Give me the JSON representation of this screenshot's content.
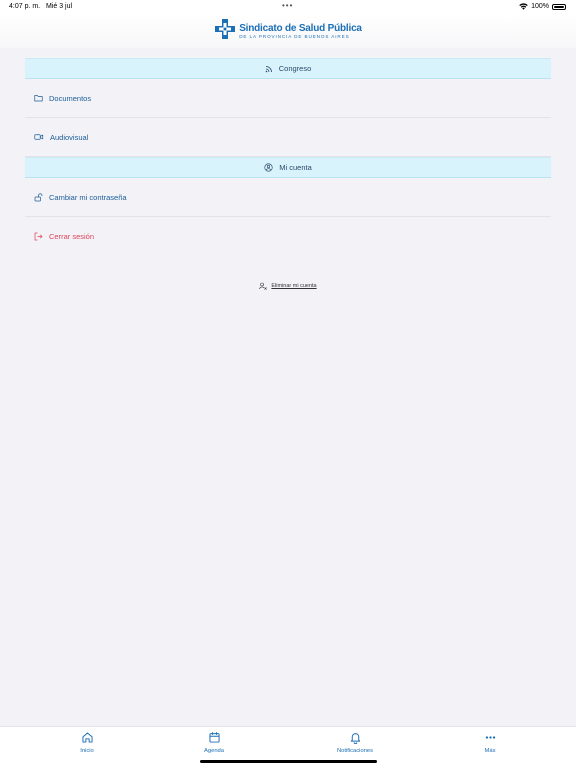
{
  "status": {
    "time": "4:07 p. m.",
    "date": "Mié 3 jul",
    "dots": "•••",
    "battery": "100%",
    "battery_level": 1.0
  },
  "header": {
    "logo_title": "Sindicato de Salud Pública",
    "logo_subtitle": "DE LA PROVINCIA DE BUENOS AIRES",
    "brand_color": "#1c6fb5"
  },
  "sections": {
    "congreso": {
      "title": "Congreso",
      "items": {
        "documentos": "Documentos",
        "audiovisual": "Audiovisual"
      }
    },
    "cuenta": {
      "title": "Mi cuenta",
      "items": {
        "cambiar": "Cambiar mi contraseña",
        "cerrar": "Cerrar sesión"
      }
    }
  },
  "delete_account": "Eliminar mi cuenta",
  "tabs": {
    "inicio": "Inicio",
    "agenda": "Agenda",
    "notificaciones": "Notificaciones",
    "mas": "Más"
  },
  "colors": {
    "accent": "#1c6fb5",
    "danger": "#e0425a",
    "section_bg": "#d8f3fb"
  }
}
